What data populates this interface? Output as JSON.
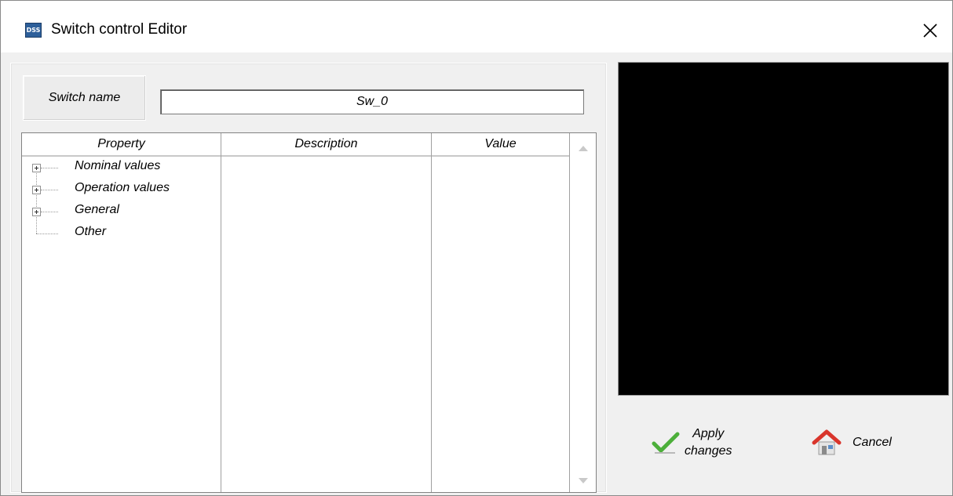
{
  "window": {
    "title": "Switch control Editor",
    "app_icon_text": "DSS",
    "close_glyph": "✕",
    "icons": {
      "app": "dss-app-icon",
      "close": "close-icon"
    }
  },
  "name_row": {
    "label": "Switch name",
    "value": "Sw_0"
  },
  "grid": {
    "columns": [
      "Property",
      "Description",
      "Value"
    ],
    "rows": [
      {
        "label": "Nominal values",
        "expandable": true
      },
      {
        "label": "Operation values",
        "expandable": true
      },
      {
        "label": "General",
        "expandable": true
      },
      {
        "label": "Other",
        "expandable": false
      }
    ]
  },
  "buttons": {
    "apply_label_line1": "Apply",
    "apply_label_line2": "changes",
    "apply_icon": "checkmark-icon",
    "cancel_label": "Cancel",
    "cancel_icon": "home-icon"
  },
  "colors": {
    "preview_bg": "#000000",
    "check_green": "#4caf3a",
    "home_red": "#d9352c"
  }
}
